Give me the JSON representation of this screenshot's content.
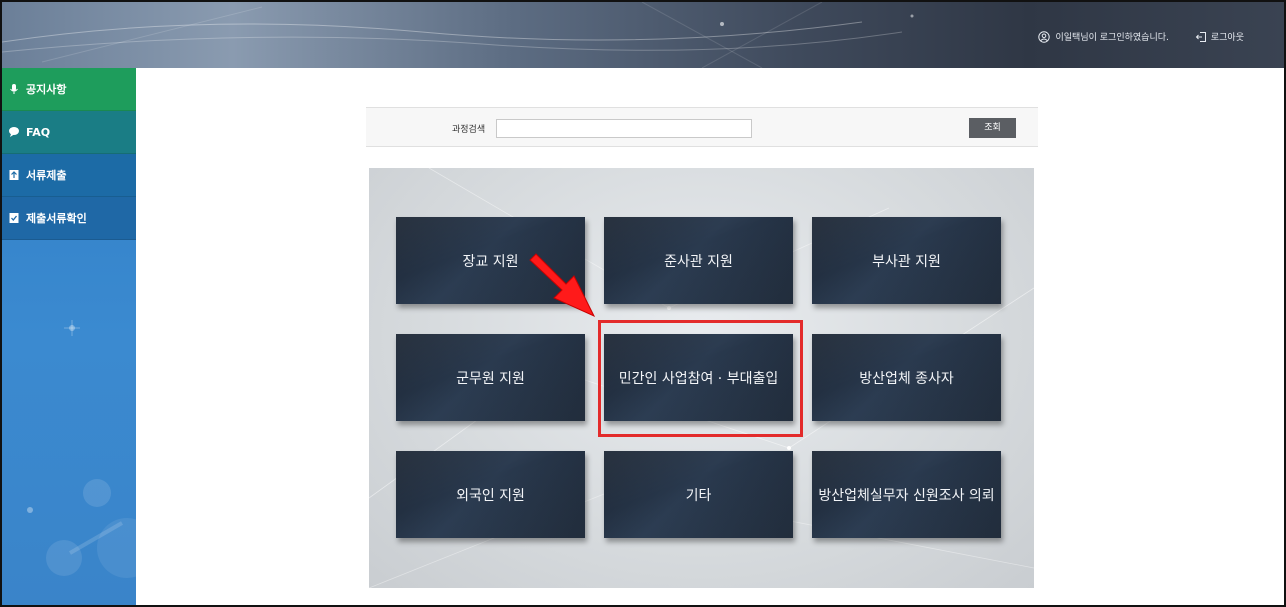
{
  "header": {
    "user_message": "이일택님이 로그인하였습니다.",
    "logout_label": "로그아웃"
  },
  "sidebar": {
    "items": [
      {
        "label": "공지사항",
        "icon": "mic-icon"
      },
      {
        "label": "FAQ",
        "icon": "chat-icon"
      },
      {
        "label": "서류제출",
        "icon": "upload-icon"
      },
      {
        "label": "제출서류확인",
        "icon": "check-doc-icon"
      }
    ]
  },
  "search": {
    "label": "과정검색",
    "value": "",
    "button_label": "조회"
  },
  "tiles": [
    {
      "label": "장교 지원"
    },
    {
      "label": "준사관 지원"
    },
    {
      "label": "부사관 지원"
    },
    {
      "label": "군무원 지원"
    },
    {
      "label": "민간인 사업참여 · 부대출입"
    },
    {
      "label": "방산업체 종사자"
    },
    {
      "label": "외국인 지원"
    },
    {
      "label": "기타"
    },
    {
      "label": "방산업체실무자 신원조사 의뢰"
    }
  ],
  "colors": {
    "highlight": "#e32b2b",
    "nav_notice": "#1e9d5c",
    "nav_faq": "#1a7d85",
    "nav_submit": "#1c6ba6",
    "search_button": "#5b5e63"
  }
}
